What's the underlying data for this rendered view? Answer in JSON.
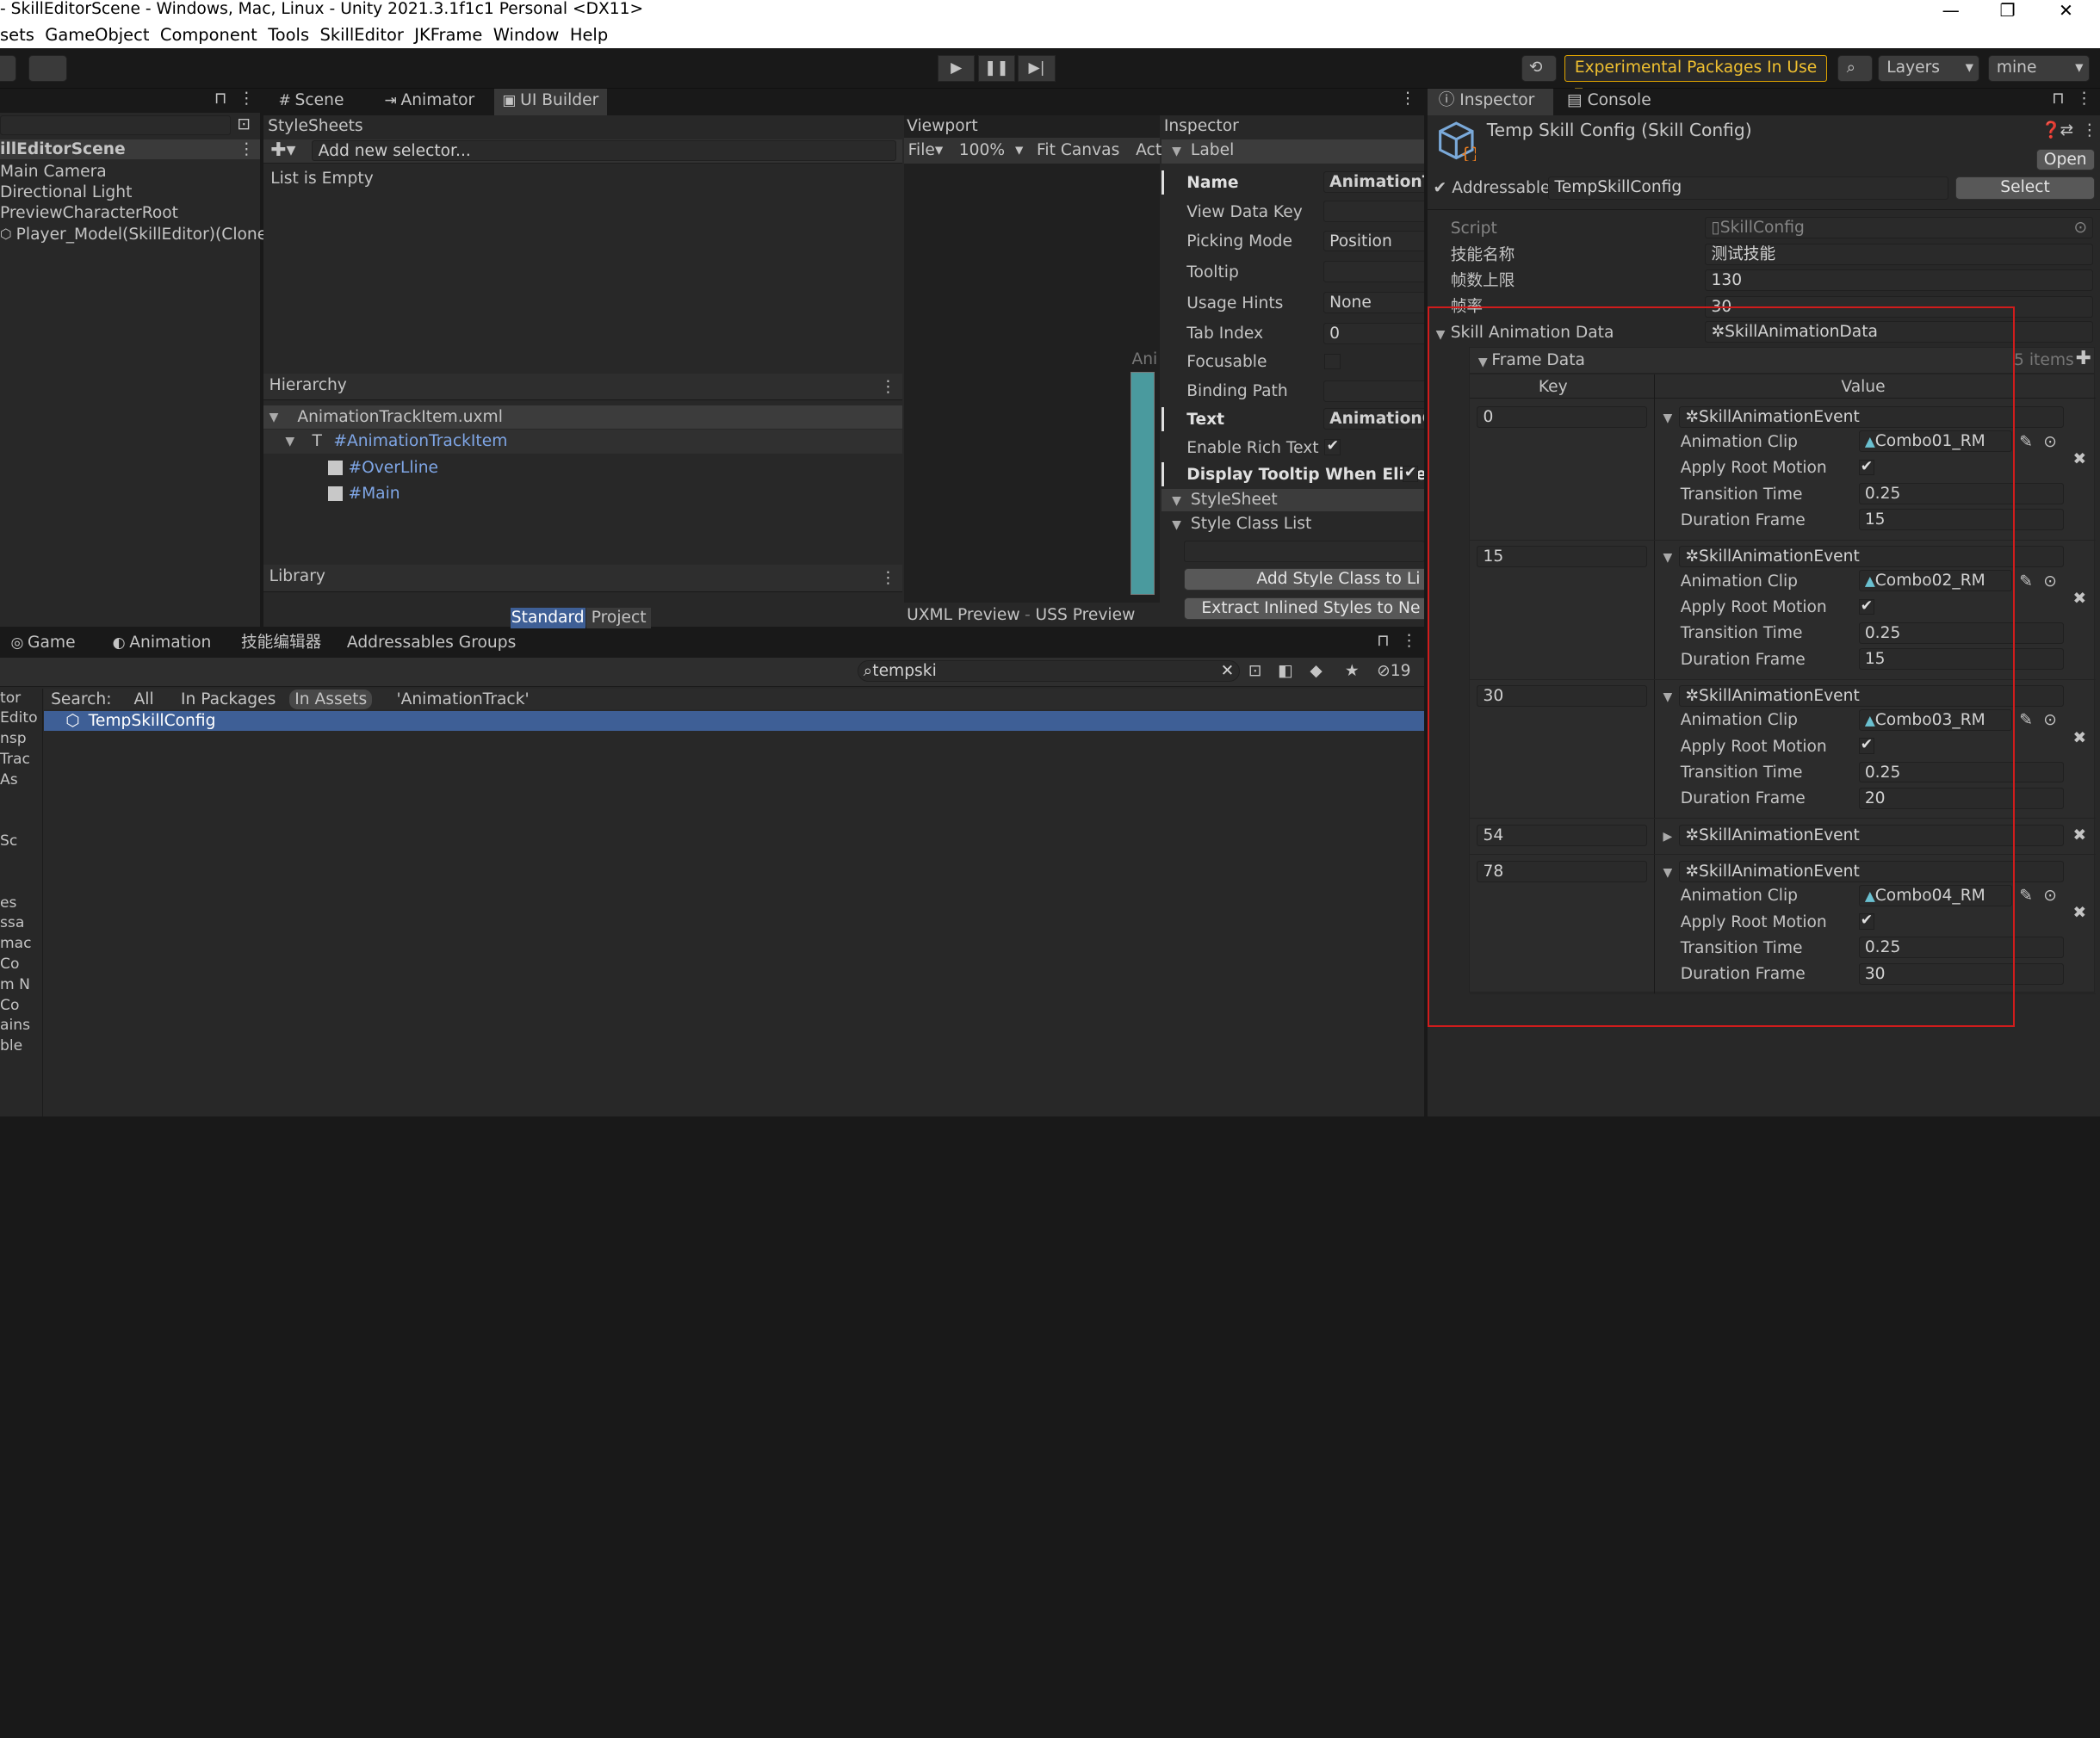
{
  "window": {
    "title": "- SkillEditorScene - Windows, Mac, Linux - Unity 2021.3.1f1c1 Personal <DX11>"
  },
  "menu": [
    "sets",
    "GameObject",
    "Component",
    "Tools",
    "SkillEditor",
    "JKFrame",
    "Window",
    "Help"
  ],
  "toolbar": {
    "experimental": "Experimental Packages In Use",
    "layers": "Layers",
    "layout": "mine"
  },
  "hierarchy": {
    "scene": "illEditorScene",
    "items": [
      "Main Camera",
      "Directional Light",
      "PreviewCharacterRoot",
      "Player_Model(SkillEditor)(Clone)"
    ]
  },
  "center_tabs": [
    "Scene",
    "Animator",
    "UI Builder"
  ],
  "stylesheets": {
    "title": "StyleSheets",
    "placeholder": "Add new selector...",
    "empty": "List is Empty"
  },
  "uib_hierarchy": {
    "title": "Hierarchy",
    "file": "AnimationTrackItem.uxml",
    "items": [
      "#AnimationTrackItem",
      "#OverLline",
      "#Main"
    ]
  },
  "library": {
    "title": "Library",
    "tabs": [
      "Standard",
      "Project"
    ]
  },
  "viewport": {
    "title": "Viewport",
    "file": "File",
    "zoom": "100%",
    "fit": "Fit Canvas",
    "act": "Act",
    "ani": "Ani",
    "uxml": "UXML Preview",
    "uss": "USS Preview"
  },
  "uib_inspector": {
    "title": "Inspector",
    "section": "Label",
    "fields": [
      {
        "label": "Name",
        "value": "AnimationTr",
        "bold": true
      },
      {
        "label": "View Data Key",
        "value": ""
      },
      {
        "label": "Picking Mode",
        "value": "Position"
      },
      {
        "label": "Tooltip",
        "value": ""
      },
      {
        "label": "Usage Hints",
        "value": "None"
      },
      {
        "label": "Tab Index",
        "value": "0"
      },
      {
        "label": "Focusable",
        "value": ""
      },
      {
        "label": "Binding Path",
        "value": ""
      },
      {
        "label": "Text",
        "value": "AnimationCl",
        "bold": true
      },
      {
        "label": "Enable Rich Text",
        "value": "✔"
      },
      {
        "label": "Display Tooltip When Elided",
        "value": "✔",
        "bold": true
      }
    ],
    "stylesheet": "StyleSheet",
    "style_class_list": "Style Class List",
    "add_style": "Add Style Class to Li",
    "extract": "Extract Inlined Styles to Ne"
  },
  "bottom_tabs": [
    "Game",
    "Animation",
    "技能编辑器",
    "Addressables Groups"
  ],
  "project": {
    "search_value": "tempski",
    "count": "19",
    "search_label": "Search:",
    "filters": [
      "All",
      "In Packages",
      "In Assets",
      "'AnimationTrack'"
    ],
    "result": "TempSkillConfig",
    "left_labels": [
      "tor",
      "Edito",
      "nsp",
      "Trac",
      "As",
      "",
      "",
      "Sc",
      "",
      "",
      "es",
      "ssa",
      "mac",
      "Co",
      "m N",
      "Co",
      "ains",
      "ble"
    ]
  },
  "inspector": {
    "tabs": [
      "Inspector",
      "Console"
    ],
    "object_title": "Temp Skill Config (Skill Config)",
    "open": "Open",
    "addressable_label": "Addressable",
    "addressable_value": "TempSkillConfig",
    "select": "Select",
    "script_label": "Script",
    "script_value": "SkillConfig",
    "props": [
      {
        "label": "技能名称",
        "value": "测试技能"
      },
      {
        "label": "帧数上限",
        "value": "130"
      },
      {
        "label": "帧率",
        "value": "30"
      }
    ],
    "anim_data_label": "Skill Animation Data",
    "anim_data_value": "SkillAnimationData",
    "frame_data_label": "Frame Data",
    "items_count": "5 items",
    "col_key": "Key",
    "col_value": "Value",
    "event_type": "SkillAnimationEvent",
    "sub_labels": [
      "Animation Clip",
      "Apply Root Motion",
      "Transition Time",
      "Duration Frame"
    ],
    "entries": [
      {
        "key": "0",
        "clip": "Combo01_RM",
        "transition": "0.25",
        "duration": "15",
        "expanded": true
      },
      {
        "key": "15",
        "clip": "Combo02_RM",
        "transition": "0.25",
        "duration": "15",
        "expanded": true
      },
      {
        "key": "30",
        "clip": "Combo03_RM",
        "transition": "0.25",
        "duration": "20",
        "expanded": true
      },
      {
        "key": "54",
        "expanded": false
      },
      {
        "key": "78",
        "clip": "Combo04_RM",
        "transition": "0.25",
        "duration": "30",
        "expanded": true
      }
    ]
  },
  "colors": {
    "accent": "#3e5f96",
    "warning": "#e1a500",
    "highlight": "#d01c1c"
  }
}
